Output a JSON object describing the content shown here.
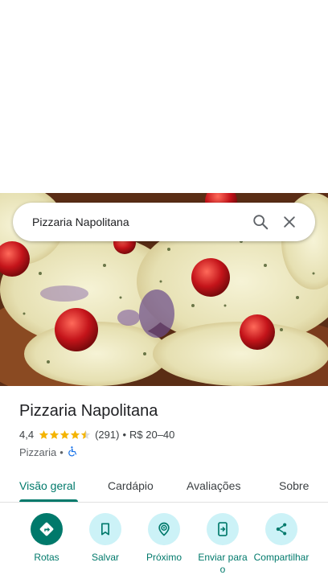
{
  "search": {
    "value": "Pizzaria Napolitana",
    "icons": [
      "search-icon",
      "close-icon"
    ]
  },
  "place": {
    "name": "Pizzaria Napolitana",
    "rating": "4,4",
    "stars": 4.4,
    "reviews": "(291)",
    "separator": "•",
    "price": "R$ 20–40",
    "category": "Pizzaria",
    "category_separator": "•"
  },
  "tabs": [
    {
      "label": "Visão geral",
      "active": true
    },
    {
      "label": "Cardápio",
      "active": false
    },
    {
      "label": "Avaliações",
      "active": false
    },
    {
      "label": "Sobre",
      "active": false
    }
  ],
  "actions": [
    {
      "label": "Rotas",
      "icon": "directions-icon"
    },
    {
      "label": "Salvar",
      "icon": "bookmark-icon"
    },
    {
      "label": "Próximo",
      "icon": "nearby-icon"
    },
    {
      "label": "Enviar para o",
      "icon": "send-to-phone-icon"
    },
    {
      "label": "Compartilhar",
      "icon": "share-icon"
    }
  ],
  "colors": {
    "accent": "#00796b",
    "star": "#f4b400",
    "chip": "#ccf2f7",
    "accessible": "#1a73e8"
  }
}
